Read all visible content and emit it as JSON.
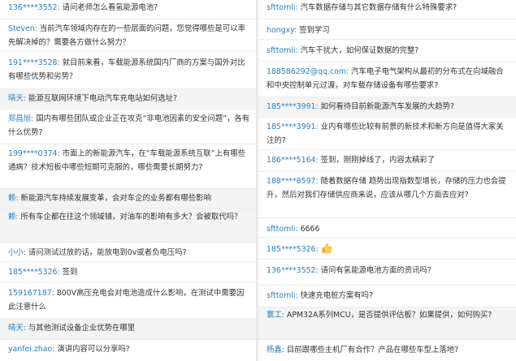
{
  "left_column": [
    {
      "name": "136****3552:",
      "text": "请问老师怎么看氢能源电池?"
    },
    {
      "name": "Steven:",
      "text": "当前汽车领域内存在的一些层面的问题，您觉得哪些是可以率先解决掉的？需要各方做什么努力？"
    },
    {
      "name": "191****3528:",
      "text": "就目前来看，车载能源系统国内厂商的方案与国外对比有哪些优势和劣势？"
    },
    {
      "name": "晴天:",
      "text": "能源互联网环境下电动汽车充电站如何选址?"
    },
    {
      "name": "郑昌旭:",
      "text": "国内有哪些团队或企业正在攻克“非电池因素的安全问题”，各有什么优势?"
    },
    {
      "name": "199****0374:",
      "text": "市面上的新能源汽车，在“车载能源系统互联”上有哪些通病？技术短板中哪些短期可克服的，哪些需要长期努力?"
    },
    {
      "name": "赖:",
      "text": "新能源汽车持续发展变革，会对车企的业务都有哪些影响"
    },
    {
      "name": "赖:",
      "text": "所有车企都在往这个领域铺，对油车的影响有多大？会被取代吗？"
    },
    {
      "name": "小小:",
      "text": "请问测试过放的话，能放电到0v或者负电压吗?"
    },
    {
      "name": "185****5326:",
      "text": "签到"
    },
    {
      "name": "159167187:",
      "text": "800V高压充电会对电池造成什么影响，在测试中需要因此注意什么"
    },
    {
      "name": "晴天:",
      "text": "与其他测试设备企业优势在哪里"
    },
    {
      "name": "yanfei.zhao:",
      "text": "演讲内容可以分享吗?"
    }
  ],
  "right_column": [
    {
      "name": "sfttomli:",
      "text": "汽车数据存储与其它数据存储有什么特殊要求?"
    },
    {
      "name": "hongxy:",
      "text": "签到学习"
    },
    {
      "name": "sfttomli:",
      "text": "汽车干扰大，如何保证数据的完整?"
    },
    {
      "name": "188586292@qq.com:",
      "text": "汽车电子电气架构从最初的分布式在向域融合和中央控制单元过渡，对车载存储设备有哪些要求?"
    },
    {
      "name": "185****3991:",
      "text": "如何看待目前新能源汽车发展的大趋势?"
    },
    {
      "name": "185****3991:",
      "text": "业内有哪些比较有前景的新技术和新方向是值得大家关注的?"
    },
    {
      "name": "186****5164:",
      "text": "签到，刚刚掉线了，内容太精彩了"
    },
    {
      "name": "188****8597:",
      "text": "随着数据存储 趋势出现指数型增长，存储的压力也会提升，然后对我们存储供应商来说，应该从哪几个方面去应对?"
    },
    {
      "name": "sfttomli:",
      "text": "6666"
    },
    {
      "name": "185****5326:",
      "text": "",
      "emoji": "thumbs-up-emoji"
    },
    {
      "name": "136****3552:",
      "text": "请问有氢能源电池方面的资讯吗?"
    },
    {
      "name": "sfttomli:",
      "text": "快速充电桩方案有吗?"
    },
    {
      "name": "寰工:",
      "text": "APM32A系列MCU，是否提供评估板？如果提供，如何购买?"
    },
    {
      "name": "杨鑫:",
      "text": "目前跟哪些主机厂有合作？产品在哪些车型上落地?"
    }
  ],
  "colors": {
    "name": "#2a7fbf",
    "text": "#333333",
    "shaded_row": "#f4f4f4",
    "divider": "#e9e9e9"
  }
}
